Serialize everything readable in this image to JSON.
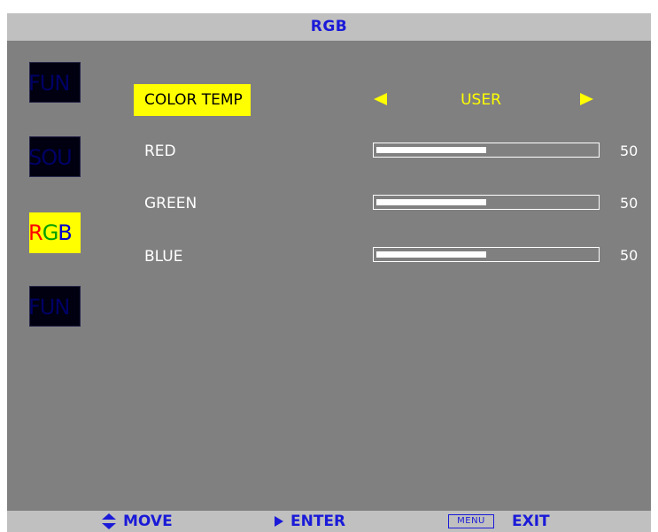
{
  "title": "RGB",
  "tabs": [
    {
      "label": "FUN"
    },
    {
      "label": "SOU"
    },
    {
      "label_r": "R",
      "label_g": "G",
      "label_b": "B",
      "selected": true
    },
    {
      "label": "FUN"
    }
  ],
  "color_temp": {
    "label": "COLOR TEMP",
    "value": "USER"
  },
  "sliders": [
    {
      "label": "RED",
      "value": "50",
      "level": 50
    },
    {
      "label": "GREEN",
      "value": "50",
      "level": 50
    },
    {
      "label": "BLUE",
      "value": "50",
      "level": 50
    }
  ],
  "footer": {
    "move": "MOVE",
    "enter": "ENTER",
    "menu_key": "MENU",
    "exit": "EXIT"
  },
  "colors": {
    "background": "#808080",
    "bar": "#c0c0c0",
    "accent_text": "#1a1ad8",
    "highlight": "#ffff00"
  }
}
